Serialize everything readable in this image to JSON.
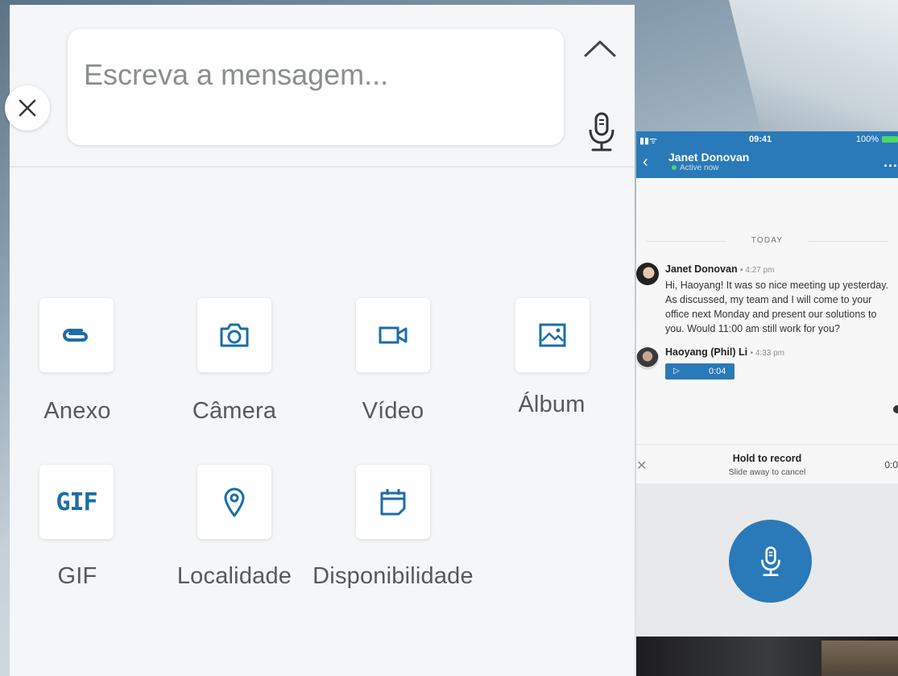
{
  "compose": {
    "placeholder": "Escreva a mensagem...",
    "close_icon": "close-icon",
    "collapse_icon": "chevron-up-icon",
    "mic_icon": "microphone-icon"
  },
  "attachments": [
    {
      "label": "Anexo",
      "icon": "paperclip-icon"
    },
    {
      "label": "Câmera",
      "icon": "camera-icon"
    },
    {
      "label": "Vídeo",
      "icon": "video-camera-icon"
    },
    {
      "label": "Álbum",
      "icon": "image-icon"
    },
    {
      "label": "GIF",
      "icon": "gif-icon",
      "icon_text": "GIF"
    },
    {
      "label": "Localidade",
      "icon": "location-pin-icon"
    },
    {
      "label": "Disponibilidade",
      "icon": "calendar-icon"
    }
  ],
  "colors": {
    "accent": "#1b6ea6",
    "header": "#2a79b8",
    "online": "#4cd964"
  },
  "phone": {
    "status": {
      "time": "09:41",
      "battery": "100%"
    },
    "header": {
      "name": "Janet Donovan",
      "status": "Active now",
      "more": "..."
    },
    "divider": "TODAY",
    "messages": [
      {
        "sender": "Janet Donovan",
        "time": "4:27 pm",
        "text": "Hi, Haoyang! It was so nice meeting up yesterday. As discussed, my team and I will come to your office next Monday and present our solutions to you. Would 11:00 am still work for you?"
      },
      {
        "sender": "Haoyang (Phil) Li",
        "time": "4:33 pm",
        "voice_duration": "0:04"
      }
    ],
    "record": {
      "title": "Hold to record",
      "hint": "Slide away to cancel",
      "counter": "0:0"
    }
  }
}
